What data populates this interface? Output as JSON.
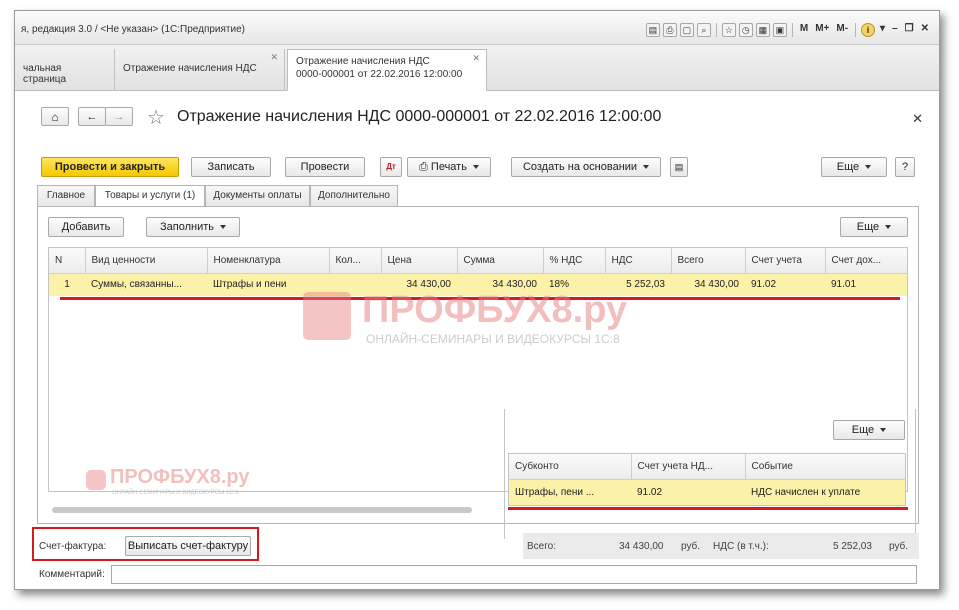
{
  "window": {
    "app_title": "я, редакция 3.0 / <Не указан>  (1С:Предприятие)",
    "toolbar_icons": [
      "save-icon",
      "print-icon",
      "preview-icon",
      "find-icon",
      "favorite-icon",
      "history-icon",
      "calendar-icon",
      "calculator-icon"
    ],
    "memory_buttons": [
      "M",
      "M+",
      "M-"
    ],
    "info_icon": "i"
  },
  "tabs": [
    {
      "label": "чальная страница"
    },
    {
      "label": "Отражение начисления НДС"
    },
    {
      "label_line1": "Отражение начисления НДС",
      "label_line2": "0000-000001 от 22.02.2016 12:00:00"
    }
  ],
  "form": {
    "title": "Отражение начисления НДС 0000-000001 от 22.02.2016 12:00:00",
    "nav": {
      "home": "⌂",
      "back": "←",
      "forward": "→"
    },
    "buttons": {
      "post_close": "Провести и закрыть",
      "save": "Записать",
      "post": "Провести",
      "print": "Печать",
      "create_based": "Создать на основании",
      "more": "Еще",
      "help": "?"
    },
    "page_tabs": [
      "Главное",
      "Товары и услуги (1)",
      "Документы оплаты",
      "Дополнительно"
    ],
    "table_buttons": {
      "add": "Добавить",
      "fill": "Заполнить",
      "more": "Еще"
    },
    "table": {
      "columns": [
        "N",
        "Вид ценности",
        "Номенклатура",
        "Кол...",
        "Цена",
        "Сумма",
        "% НДС",
        "НДС",
        "Всего",
        "Счет учета",
        "Счет дох..."
      ],
      "rows": [
        [
          "1",
          "Суммы, связанны...",
          "Штрафы и пени",
          "",
          "34 430,00",
          "34 430,00",
          "18%",
          "5 252,03",
          "34 430,00",
          "91.02",
          "91.01"
        ]
      ]
    },
    "sub": {
      "more": "Еще",
      "columns": [
        "Субконто",
        "Счет учета НД...",
        "Событие"
      ],
      "rows": [
        [
          "Штрафы, пени ...",
          "91.02",
          "НДС начислен к уплате"
        ]
      ]
    },
    "watermark": {
      "big_title": "ПРОФБУХ8.ру",
      "big_sub": "ОНЛАЙН-СЕМИНАРЫ И ВИДЕОКУРСЫ 1С:8",
      "small_title": "ПРОФБУХ8.ру",
      "small_sub": "ОНЛАЙН СЕМИНАРЫ И ВИДЕОКУРСЫ 1С:8"
    },
    "invoice": {
      "label": "Счет-фактура:",
      "button": "Выписать счет-фактуру"
    },
    "summary": {
      "total_label": "Всего:",
      "total_value": "34 430,00",
      "total_currency": "руб.",
      "vat_label": "НДС (в т.ч.):",
      "vat_value": "5 252,03",
      "vat_currency": "руб."
    },
    "comment_label": "Комментарий:",
    "colors": {
      "accent_yellow": "#f5c800",
      "selection": "#fbf1a8",
      "highlight_red": "#d71920"
    }
  }
}
